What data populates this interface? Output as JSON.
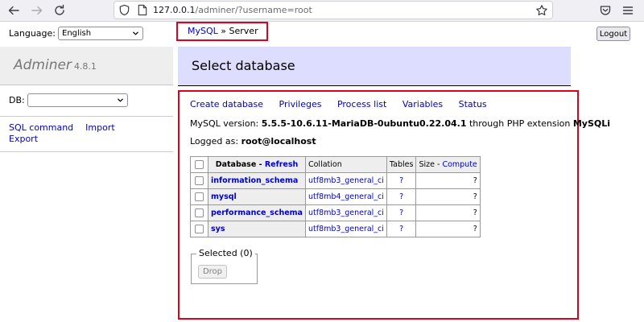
{
  "browser": {
    "url_host": "127.0.0.1",
    "url_path": "/adminer/?username=root"
  },
  "language": {
    "label": "Language:",
    "selected": "English"
  },
  "breadcrumb": {
    "link": "MySQL",
    "separator": " » ",
    "current": "Server"
  },
  "logout_label": "Logout",
  "brand": {
    "name": "Adminer",
    "version": "4.8.1"
  },
  "db_select": {
    "label": "DB:",
    "selected": ""
  },
  "sidebar_links": {
    "sql_command": "SQL command",
    "import": "Import",
    "export": "Export"
  },
  "page_title": "Select database",
  "menu": {
    "create_database": "Create database",
    "privileges": "Privileges",
    "process_list": "Process list",
    "variables": "Variables",
    "status": "Status"
  },
  "server_info": {
    "prefix": "MySQL version: ",
    "version": "5.5.5-10.6.11-MariaDB-0ubuntu0.22.04.1",
    "middle": " through PHP extension ",
    "extension": "MySQLi"
  },
  "logged": {
    "prefix": "Logged as: ",
    "user": "root@localhost"
  },
  "table": {
    "headers": {
      "database": "Database",
      "sep": " - ",
      "refresh": "Refresh",
      "collation": "Collation",
      "tables": "Tables",
      "size": "Size",
      "compute": "Compute"
    },
    "rows": [
      {
        "name": "information_schema",
        "collation": "utf8mb3_general_ci",
        "tables": "?",
        "size": "?"
      },
      {
        "name": "mysql",
        "collation": "utf8mb4_general_ci",
        "tables": "?",
        "size": "?"
      },
      {
        "name": "performance_schema",
        "collation": "utf8mb3_general_ci",
        "tables": "?",
        "size": "?"
      },
      {
        "name": "sys",
        "collation": "utf8mb3_general_ci",
        "tables": "?",
        "size": "?"
      }
    ]
  },
  "selected": {
    "legend": "Selected (0)",
    "drop_label": "Drop"
  },
  "icons": {
    "back": "arrow-left-icon",
    "forward": "arrow-right-icon",
    "reload": "reload-icon",
    "shield": "shield-icon",
    "page": "page-icon",
    "star": "star-icon",
    "pocket": "pocket-icon",
    "menu": "hamburger-menu-icon"
  },
  "colors": {
    "header_band": "#ddddff",
    "link": "#0000cc",
    "highlight_border": "#e0001b"
  }
}
